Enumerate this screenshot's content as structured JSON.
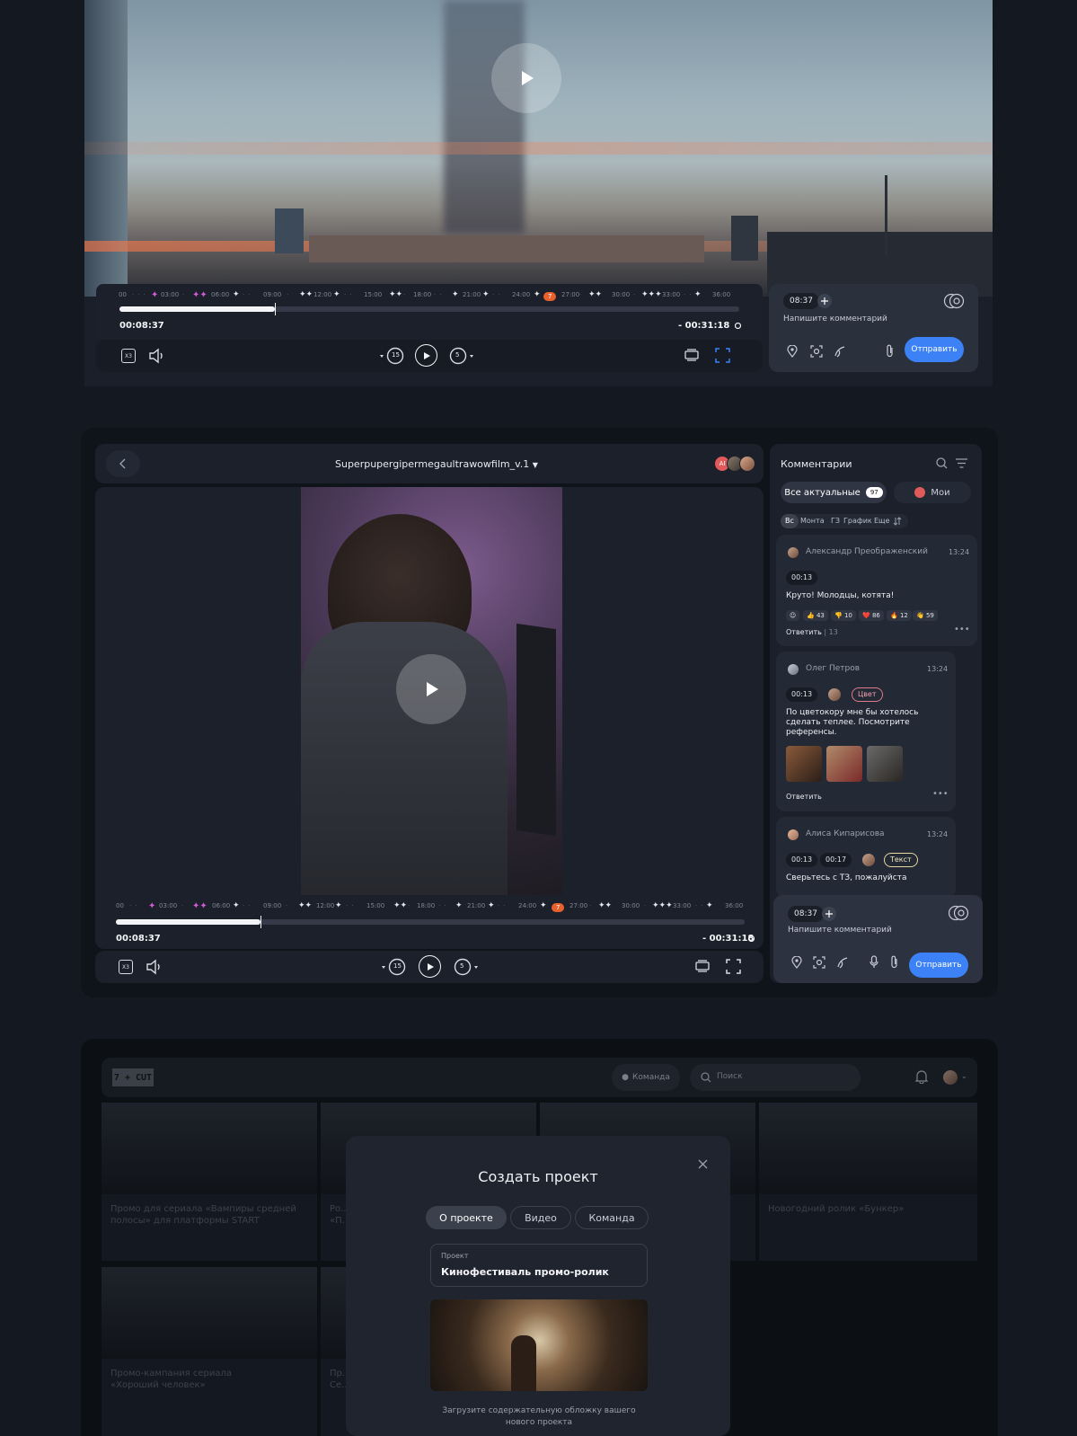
{
  "section1": {
    "play_label": "",
    "timeline": {
      "ticks": [
        "00",
        "03:00",
        "06:00",
        "09:00",
        "12:00",
        "15:00",
        "18:00",
        "21:00",
        "24:00",
        "27:00",
        "30:00",
        "33:00",
        "36:00"
      ],
      "marker_badge": "7",
      "progress_fraction": 0.25,
      "current_time": "00:08:37",
      "remaining_time": "- 00:31:18"
    },
    "controls": {
      "speed_label": "X3",
      "rewind_label": "15",
      "forward_label": "5"
    },
    "comment": {
      "time_chip": "08:37",
      "placeholder": "Напишите комментарий",
      "send_label": "Отправить"
    }
  },
  "section2": {
    "title": "Superpupergipermegaultrawowfilm_v.1",
    "avatar_initials": "AI",
    "timeline": {
      "ticks": [
        "00",
        "03:00",
        "06:00",
        "09:00",
        "12:00",
        "15:00",
        "18:00",
        "21:00",
        "24:00",
        "27:00",
        "30:00",
        "33:00",
        "36:00"
      ],
      "marker_badge": "7",
      "progress_fraction": 0.23,
      "current_time": "00:08:37",
      "remaining_time": "- 00:31:18"
    },
    "controls": {
      "speed_label": "X3",
      "rewind_label": "15",
      "forward_label": "5"
    },
    "comments_panel": {
      "title": "Комментарии",
      "tab_all": "Все актуальные",
      "tab_all_count": "97",
      "tab_mine": "Мои",
      "filters": [
        "Вс",
        "Монта",
        "ГЗ",
        "График",
        "Еще"
      ],
      "comments": [
        {
          "author": "Александр Преображенский",
          "time": "13:24",
          "timestamps": [
            "00:13"
          ],
          "text": "Круто! Молодцы, котята!",
          "reactions": [
            "👍 43",
            "👎 10",
            "❤️ 86",
            "🔥 12",
            "👋 59"
          ],
          "reply_label": "Ответить",
          "reply_count": "13"
        },
        {
          "author": "Олег Петров",
          "time": "13:24",
          "timestamps": [
            "00:13"
          ],
          "tag": "Цвет",
          "text": "По цветокору мне бы хотелось сделать теплее. Посмотрите референсы.",
          "reply_label": "Ответить"
        },
        {
          "author": "Алиса Кипарисова",
          "time": "13:24",
          "timestamps": [
            "00:13",
            "00:17"
          ],
          "tag": "Текст",
          "text": "Сверьтесь с ТЗ, пожалуйста"
        }
      ],
      "composer": {
        "time_chip": "08:37",
        "placeholder": "Напишите комментарий",
        "send_label": "Отправить"
      }
    }
  },
  "section3": {
    "logo": "7 + CUT",
    "team_label": "Команда",
    "search_placeholder": "Поиск",
    "cards": [
      {
        "title": "Промо для сериала «Вампиры средней полосы» для платформы START"
      },
      {
        "title": "Ро... «П..."
      },
      {
        "title": ""
      },
      {
        "title": "Новогодний ролик «Бункер»"
      },
      {
        "title": "Промо-кампания сериала «Хороший человек»"
      },
      {
        "title": "Пр... Се..."
      }
    ],
    "modal": {
      "title": "Создать проект",
      "tabs": [
        "О проекте",
        "Видео",
        "Команда"
      ],
      "field_label": "Проект",
      "field_value": "Кинофестиваль промо-ролик",
      "upload_hint": "Загрузите содержательную обложку вашего нового проекта"
    }
  }
}
